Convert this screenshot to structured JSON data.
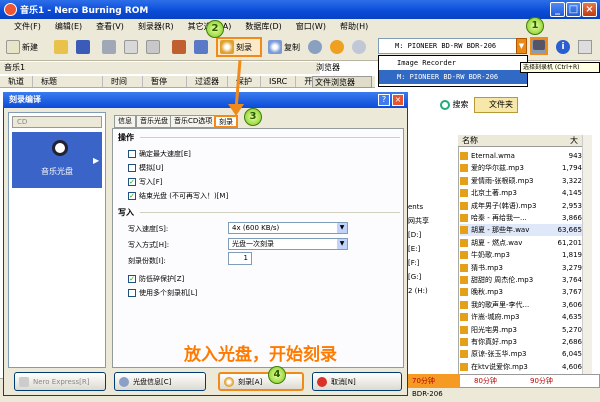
{
  "window": {
    "title": "音乐1 - Nero Burning ROM"
  },
  "menu": [
    "文件(F)",
    "编辑(E)",
    "查看(V)",
    "刻录器(R)",
    "其它选项(A)",
    "数据库(D)",
    "窗口(W)",
    "帮助(H)"
  ],
  "toolbar": {
    "new_label": "新建",
    "burn_label": "刻录",
    "copy_label": "复制"
  },
  "device": {
    "selected": "M: PIONEER BD-RW   BDR-206",
    "options": [
      "Image Recorder",
      "M: PIONEER BD-RW   BDR-206"
    ],
    "tooltip": "选择刻录机 (Ctrl+R)"
  },
  "compilation": {
    "label": "音乐1",
    "columns": [
      "轨道",
      "标题",
      "时间",
      "暂停",
      "过滤器",
      "保护",
      "ISRC",
      "开始"
    ]
  },
  "browser": {
    "label": "浏览器",
    "tab": "文件浏览器",
    "search": "搜索",
    "folder": "文件夹"
  },
  "midtext": [
    "ents",
    "网共享",
    "[D:]",
    "[E:]",
    "[F:]",
    "[G:]",
    "2 (H:)"
  ],
  "files": {
    "header_name": "名称",
    "header_size": "大",
    "items": [
      {
        "name": "Eternal.wma",
        "size": "943"
      },
      {
        "name": "爱的华尔兹.mp3",
        "size": "1,794"
      },
      {
        "name": "爱情雨-张根硕.mp3",
        "size": "3,322"
      },
      {
        "name": "北京土著.mp3",
        "size": "4,145"
      },
      {
        "name": "成年男子(韩语).mp3",
        "size": "2,953"
      },
      {
        "name": "哈秦 - 再给我一...",
        "size": "3,866"
      },
      {
        "name": "胡夏 - 那些年.wav",
        "size": "63,665"
      },
      {
        "name": "胡夏 - 燃点.wav",
        "size": "61,201"
      },
      {
        "name": "牛奶歌.mp3",
        "size": "1,819"
      },
      {
        "name": "猜书.mp3",
        "size": "3,279"
      },
      {
        "name": "甜甜的 周杰伦.mp3",
        "size": "3,764"
      },
      {
        "name": "晚秋.mp3",
        "size": "3,767"
      },
      {
        "name": "我的歌声里-李代...",
        "size": "3,606"
      },
      {
        "name": "许嵩-城府.mp3",
        "size": "4,635"
      },
      {
        "name": "阳光宅男.mp3",
        "size": "5,270"
      },
      {
        "name": "有你真好.mp3",
        "size": "2,686"
      },
      {
        "name": "原谅-张玉华.mp3",
        "size": "6,045"
      },
      {
        "name": "在ktv说爱你.mp3",
        "size": "4,606"
      }
    ]
  },
  "capacity": {
    "ticks": [
      "70分钟",
      "80分钟",
      "90分钟"
    ],
    "fill_fraction": 0.27
  },
  "status": {
    "device": "BDR-206"
  },
  "dialog": {
    "title": "刻录编译",
    "cd_combo": "CD",
    "left_item": "音乐光盘",
    "tabs": [
      "信息",
      "音乐光盘",
      "音乐CD选项",
      "刻录"
    ],
    "section_ops": "操作",
    "checks": [
      {
        "label": "确定最大速度[E]",
        "checked": false
      },
      {
        "label": "模拟[U]",
        "checked": false
      },
      {
        "label": "写入[F]",
        "checked": true
      },
      {
        "label": "结束光盘 (不可再写入！)[M]",
        "checked": true
      }
    ],
    "section_write": "写入",
    "speed_label": "写入速度[S]:",
    "speed_value": "4x (600 KB/s)",
    "method_label": "写入方式[H]:",
    "method_value": "光盘一次刻录",
    "copies_label": "刻录份数[I]:",
    "copies_value": "1",
    "checks2": [
      {
        "label": "防低碎保护[Z]",
        "checked": true
      },
      {
        "label": "使用多个刻录机[L]",
        "checked": false
      }
    ],
    "btn_nero": "Nero Express[R]",
    "btn_info": "光盘信息[C]",
    "btn_burn": "刻录[A]",
    "btn_cancel": "取消[N]"
  },
  "annotations": {
    "caption": "放入光盘，开始刻录",
    "markers": [
      "1",
      "2",
      "3",
      "4"
    ]
  },
  "colors": {
    "accent": "#f08a1a",
    "titlebar": "#0a4bd8",
    "caption": "#ff7a00"
  }
}
